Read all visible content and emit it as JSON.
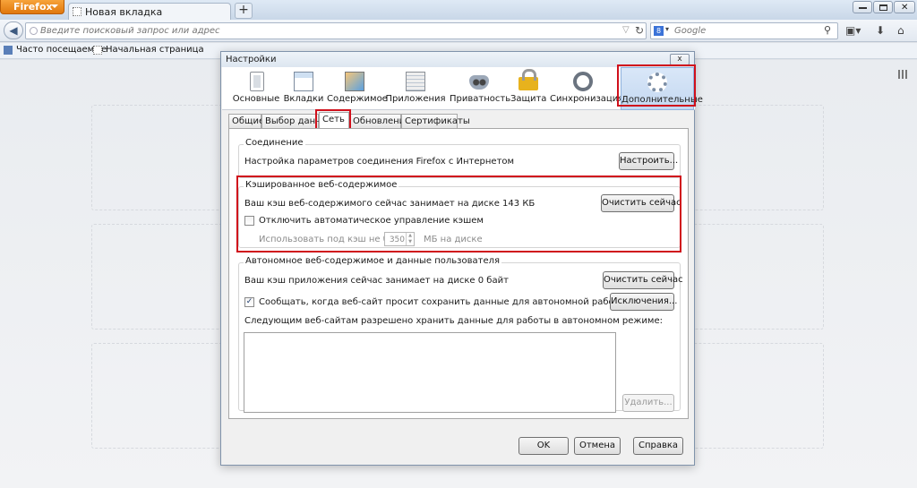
{
  "browser": {
    "app_button": "Firefox",
    "tab_title": "Новая вкладка",
    "new_tab": "+",
    "url_placeholder": "Введите поисковый запрос или адрес",
    "search_placeholder": "Google",
    "search_engine_glyph": "8",
    "bookmarks": [
      "Часто посещаемые",
      "Начальная страница"
    ]
  },
  "dialog": {
    "title": "Настройки",
    "close": "x",
    "panes": [
      {
        "label": "Основные",
        "icon": "general-icon"
      },
      {
        "label": "Вкладки",
        "icon": "tabs-icon"
      },
      {
        "label": "Содержимое",
        "icon": "content-icon"
      },
      {
        "label": "Приложения",
        "icon": "applications-icon"
      },
      {
        "label": "Приватность",
        "icon": "privacy-mask-icon"
      },
      {
        "label": "Защита",
        "icon": "security-lock-icon"
      },
      {
        "label": "Синхронизация",
        "icon": "sync-icon"
      },
      {
        "label": "Дополнительные",
        "icon": "advanced-gear-icon"
      }
    ],
    "active_pane": "Дополнительные",
    "subtabs": [
      "Общие",
      "Выбор данных",
      "Сеть",
      "Обновления",
      "Сертификаты"
    ],
    "active_subtab": "Сеть",
    "connection": {
      "caption": "Соединение",
      "description": "Настройка параметров соединения Firefox с Интернетом",
      "settings_button": "Настроить..."
    },
    "cache": {
      "caption": "Кэшированное веб-содержимое",
      "usage": "Ваш кэш веб-содержимого сейчас занимает на диске 143 КБ",
      "clear_button": "Очистить сейчас",
      "override_label": "Отключить автоматическое управление кэшем",
      "override_checked": false,
      "limit_label": "Использовать под кэш не более",
      "limit_value": "350",
      "limit_unit": "МБ на диске"
    },
    "offline": {
      "caption": "Автономное веб-содержимое и данные пользователя",
      "usage": "Ваш кэш приложения сейчас занимает на диске 0 байт",
      "clear_button": "Очистить сейчас",
      "notify_label": "Сообщать, когда веб-сайт просит сохранить данные для автономной работы",
      "notify_checked": true,
      "exceptions_button": "Исключения...",
      "list_label": "Следующим веб-сайтам разрешено хранить данные для работы в автономном режиме:",
      "remove_button": "Удалить..."
    },
    "footer": {
      "ok": "OK",
      "cancel": "Отмена",
      "help": "Справка"
    }
  },
  "colors": {
    "highlight": "#d0101c",
    "app_button": "#e0780e",
    "active_pane": "#c4d8f1"
  }
}
